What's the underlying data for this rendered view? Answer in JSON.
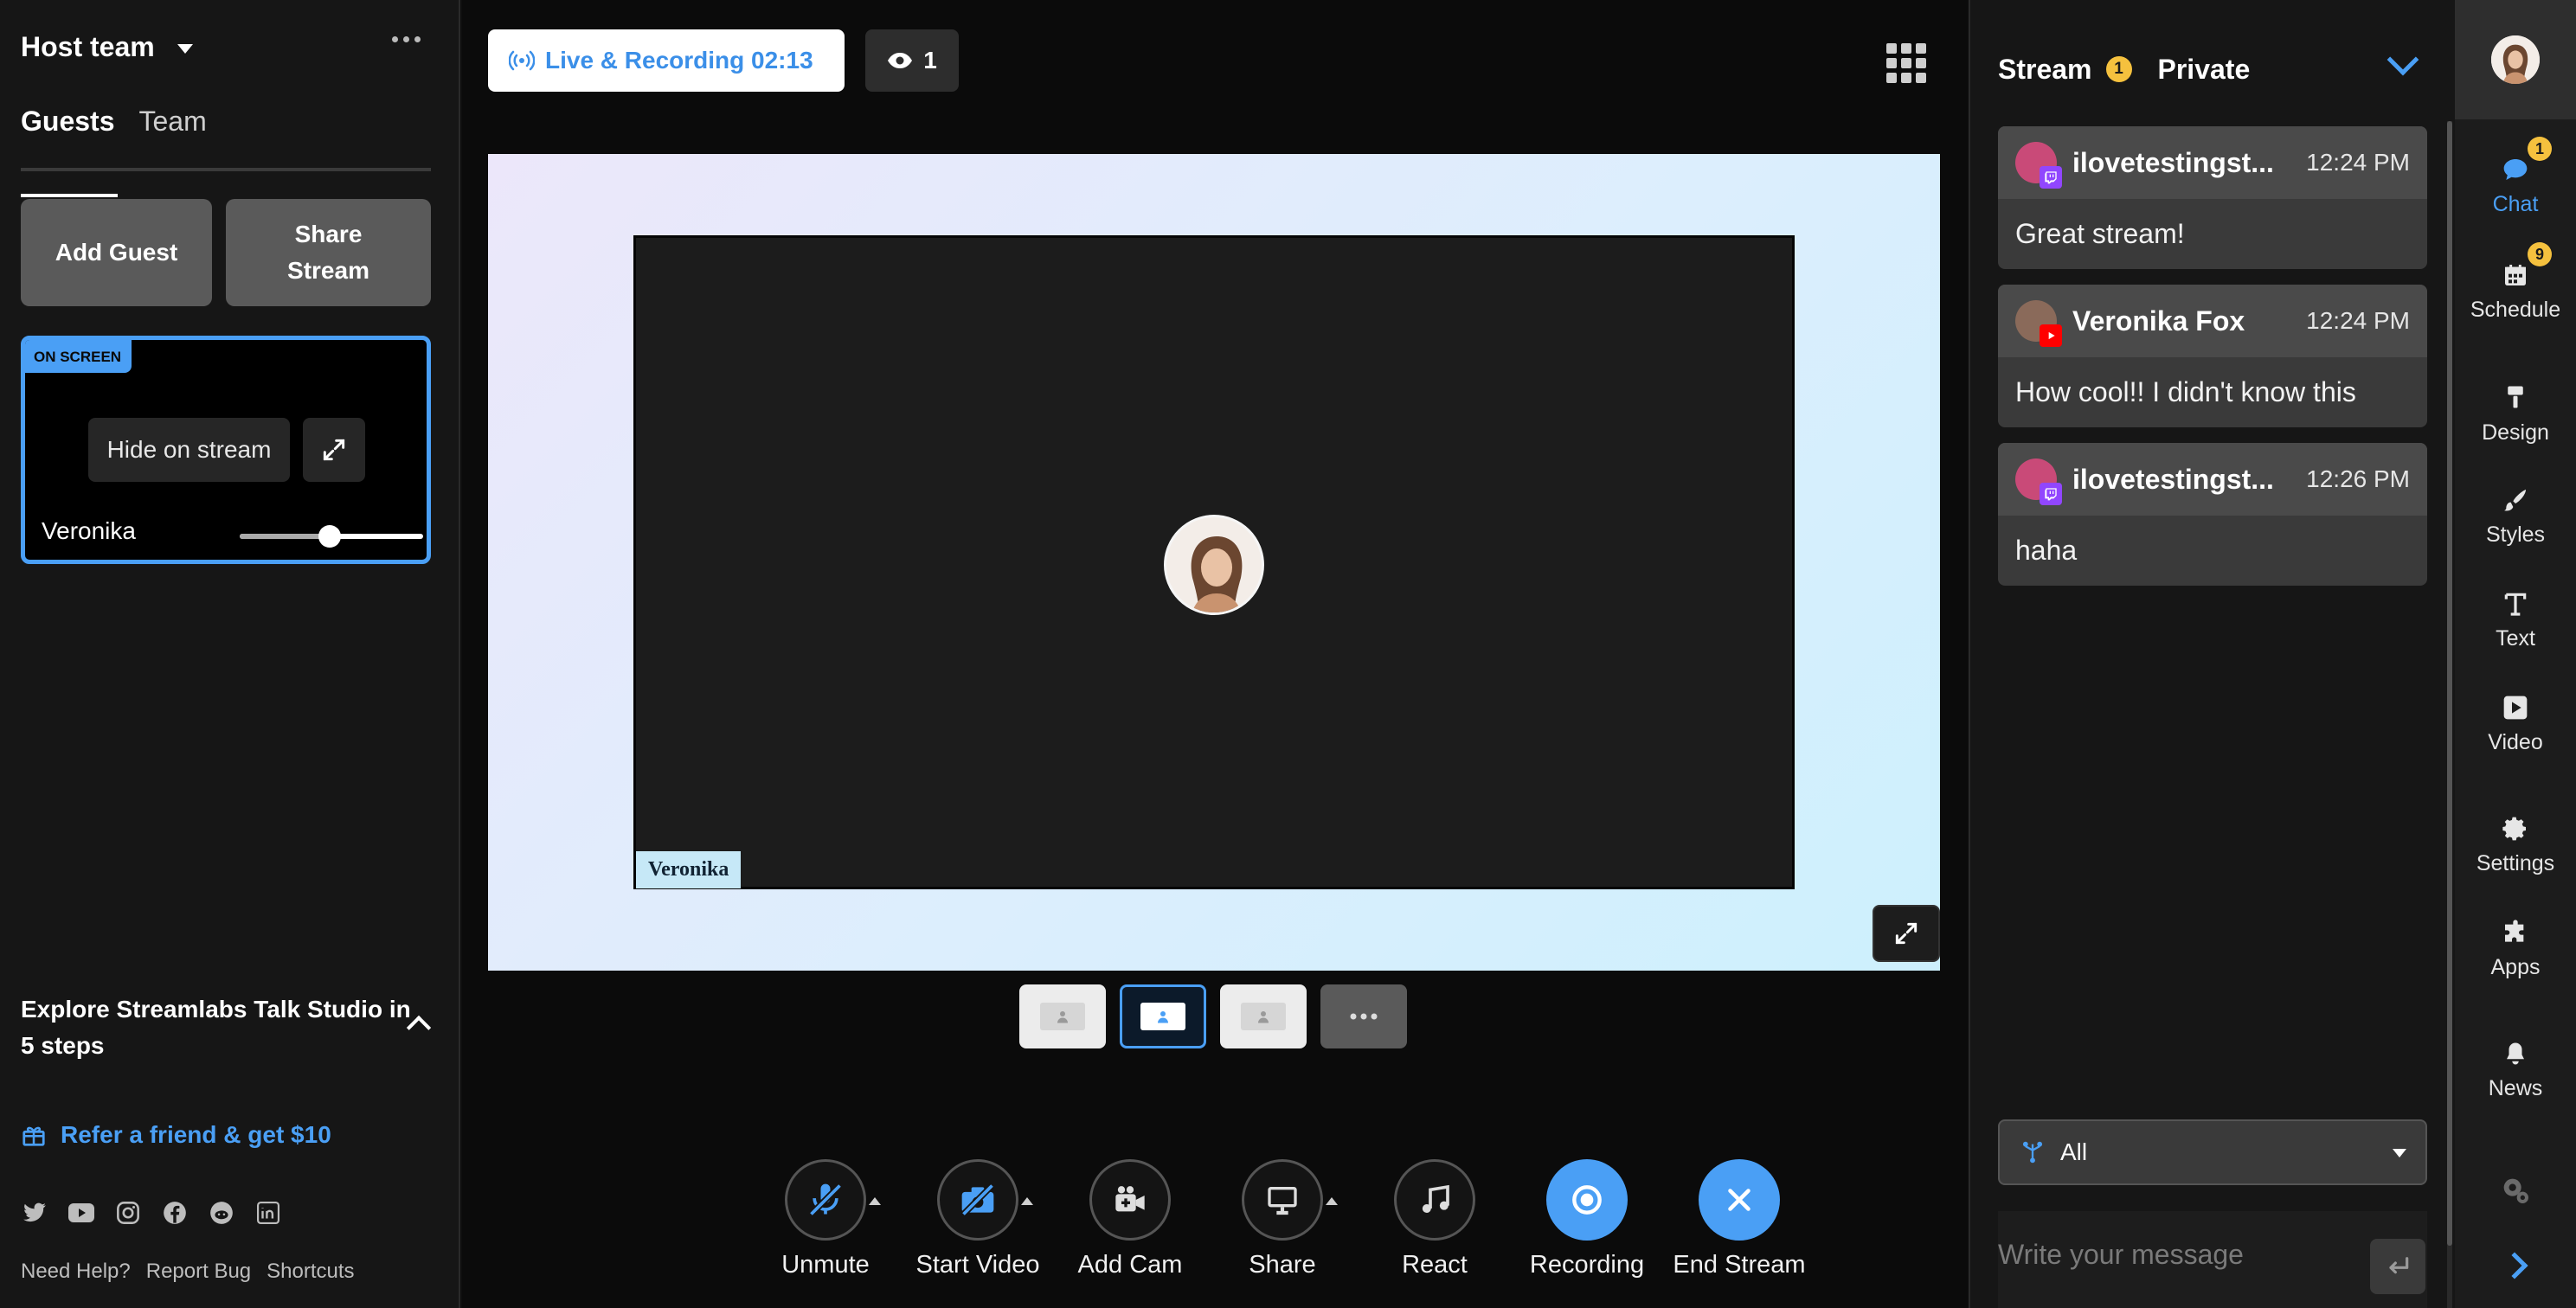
{
  "left": {
    "team_name": "Host team",
    "tabs": [
      {
        "label": "Guests",
        "active": true
      },
      {
        "label": "Team",
        "active": false
      }
    ],
    "buttons": {
      "add_guest": "Add Guest",
      "share_stream": "Share Stream"
    },
    "guest_card": {
      "badge": "ON SCREEN",
      "hide_label": "Hide on stream",
      "name": "Veronika",
      "volume": 0.49
    },
    "explore": "Explore Streamlabs Talk Studio in 5 steps",
    "refer": "Refer a friend & get $10",
    "social_icons": [
      "twitter-icon",
      "youtube-icon",
      "instagram-icon",
      "facebook-icon",
      "reddit-icon",
      "linkedin-icon"
    ],
    "footer_links": [
      "Need Help?",
      "Report Bug",
      "Shortcuts"
    ]
  },
  "center": {
    "status": "Live & Recording 02:13",
    "viewers": "1",
    "stage_name": "Veronika",
    "layouts": [
      {
        "active": false
      },
      {
        "active": true
      },
      {
        "active": false
      },
      {
        "more": true
      }
    ],
    "controls": [
      {
        "id": "unmute",
        "label": "Unmute",
        "icon": "mic-off-icon",
        "caret": true
      },
      {
        "id": "start-video",
        "label": "Start Video",
        "icon": "camera-off-icon",
        "caret": true
      },
      {
        "id": "add-cam",
        "label": "Add Cam",
        "icon": "add-camera-icon",
        "caret": false
      },
      {
        "id": "share",
        "label": "Share",
        "icon": "monitor-icon",
        "caret": true
      },
      {
        "id": "react",
        "label": "React",
        "icon": "music-note-icon",
        "caret": false
      },
      {
        "id": "recording",
        "label": "Recording",
        "icon": "record-icon",
        "caret": false,
        "blue": true
      },
      {
        "id": "end-stream",
        "label": "End Stream",
        "icon": "close-icon",
        "caret": false,
        "blue": true
      }
    ]
  },
  "chat": {
    "tabs": {
      "stream": "Stream",
      "stream_badge": "1",
      "private": "Private"
    },
    "messages": [
      {
        "user": "ilovetestingst...",
        "time": "12:24 PM",
        "text": "Great stream!",
        "platform": "twitch"
      },
      {
        "user": "Veronika Fox",
        "time": "12:24 PM",
        "text": "How cool!! I didn't know this",
        "platform": "youtube"
      },
      {
        "user": "ilovetestingst...",
        "time": "12:26 PM",
        "text": "haha",
        "platform": "twitch"
      }
    ],
    "filter": "All",
    "placeholder": "Write your message"
  },
  "rail": {
    "items": [
      {
        "label": "Chat",
        "icon": "chat-bubble-icon",
        "badge": "1",
        "active": true
      },
      {
        "label": "Schedule",
        "icon": "calendar-icon",
        "badge": "9",
        "active": false
      },
      {
        "label": "Design",
        "icon": "paint-roller-icon",
        "badge": "",
        "active": false
      },
      {
        "label": "Styles",
        "icon": "brush-icon",
        "badge": "",
        "active": false
      },
      {
        "label": "Text",
        "icon": "text-icon",
        "badge": "",
        "active": false
      },
      {
        "label": "Video",
        "icon": "play-icon",
        "badge": "",
        "active": false
      },
      {
        "label": "Settings",
        "icon": "gear-icon",
        "badge": "",
        "active": false
      },
      {
        "label": "Apps",
        "icon": "puzzle-icon",
        "badge": "",
        "active": false
      },
      {
        "label": "News",
        "icon": "bell-icon",
        "badge": "",
        "active": false
      }
    ]
  },
  "colors": {
    "accent": "#4a9ff5",
    "badge": "#f5c13e",
    "twitch": "#9146ff",
    "youtube": "#ff0000"
  }
}
